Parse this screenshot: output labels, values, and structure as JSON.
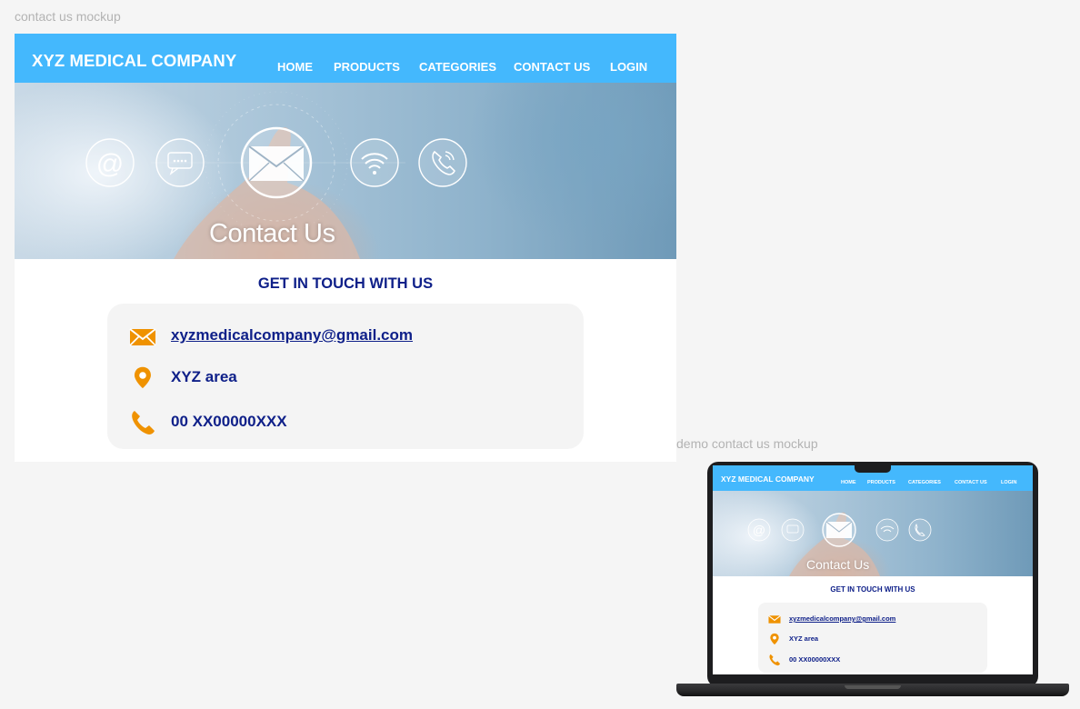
{
  "labels": {
    "main_frame": "contact us mockup",
    "demo_frame": "demo contact us mockup"
  },
  "colors": {
    "nav_bg": "#44b8fd",
    "heading_text": "#0f2089",
    "icon_orange": "#ef9200",
    "card_bg": "#f4f4f4",
    "page_bg": "#f5f5f5"
  },
  "site": {
    "brand": "XYZ MEDICAL COMPANY",
    "nav": [
      "HOME",
      "PRODUCTS",
      "CATEGORIES",
      "CONTACT US",
      "LOGIN"
    ],
    "hero_title": "Contact Us",
    "section_title": "GET IN TOUCH WITH US",
    "contact": {
      "email": "xyzmedicalcompany@gmail.com",
      "address": "XYZ area",
      "phone": "00 XX00000XXX"
    },
    "icons": {
      "email": "envelope-icon",
      "address": "map-pin-icon",
      "phone": "phone-icon",
      "hero": [
        "at-sign-icon",
        "chat-bubble-icon",
        "envelope-icon",
        "wifi-icon",
        "phone-call-icon"
      ]
    }
  }
}
